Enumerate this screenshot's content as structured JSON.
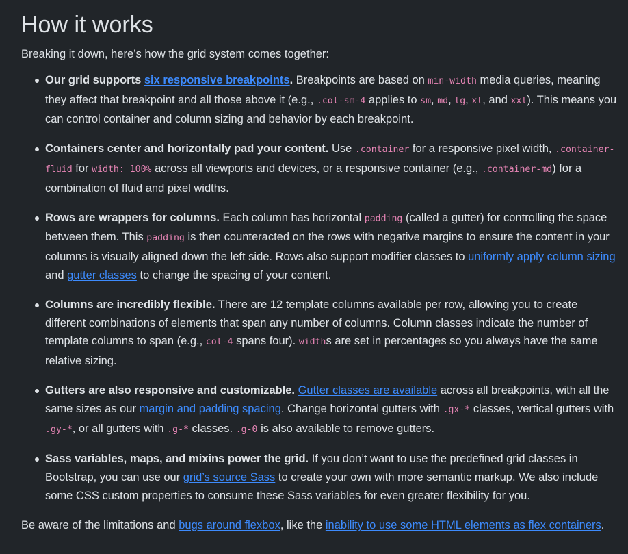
{
  "heading": "How it works",
  "intro": "Breaking it down, here’s how the grid system comes together:",
  "items": [
    {
      "bold": "Our grid supports ",
      "bold_link": "six responsive breakpoints",
      "bold_end": ".",
      "t1": " Breakpoints are based on ",
      "c1": "min-width",
      "t2": " media queries, meaning they affect that breakpoint and all those above it (e.g., ",
      "c2": ".col-sm-4",
      "t3": " applies to ",
      "c3": "sm",
      "t4": ", ",
      "c4": "md",
      "t5": ", ",
      "c5": "lg",
      "t6": ", ",
      "c6": "xl",
      "t7": ", and ",
      "c7": "xxl",
      "t8": "). This means you can control container and column sizing and behavior by each breakpoint."
    },
    {
      "bold": "Containers center and horizontally pad your content.",
      "t1": " Use ",
      "c1": ".container",
      "t2": " for a responsive pixel width, ",
      "c2": ".container-fluid",
      "t3": " for ",
      "c3": "width: 100%",
      "t4": " across all viewports and devices, or a responsive container (e.g., ",
      "c4": ".container-md",
      "t5": ") for a combination of fluid and pixel widths."
    },
    {
      "bold": "Rows are wrappers for columns.",
      "t1": " Each column has horizontal ",
      "c1": "padding",
      "t2": " (called a gutter) for controlling the space between them. This ",
      "c2": "padding",
      "t3": " is then counteracted on the rows with negative margins to ensure the content in your columns is visually aligned down the left side. Rows also support modifier classes to ",
      "l1": "uniformly apply column sizing",
      "t4": " and ",
      "l2": "gutter classes",
      "t5": " to change the spacing of your content."
    },
    {
      "bold": "Columns are incredibly flexible.",
      "t1": " There are 12 template columns available per row, allowing you to create different combinations of elements that span any number of columns. Column classes indicate the number of template columns to span (e.g., ",
      "c1": "col-4",
      "t2": " spans four). ",
      "c2": "width",
      "t3": "s are set in percentages so you always have the same relative sizing."
    },
    {
      "bold": "Gutters are also responsive and customizable.",
      "t1": " ",
      "l1": "Gutter classes are available",
      "t2": " across all breakpoints, with all the same sizes as our ",
      "l2": "margin and padding spacing",
      "t3": ". Change horizontal gutters with ",
      "c1": ".gx-*",
      "t4": " classes, vertical gutters with ",
      "c2": ".gy-*",
      "t5": ", or all gutters with ",
      "c3": ".g-*",
      "t6": " classes. ",
      "c4": ".g-0",
      "t7": " is also available to remove gutters."
    },
    {
      "bold": "Sass variables, maps, and mixins power the grid.",
      "t1": " If you don’t want to use the predefined grid classes in Bootstrap, you can use our ",
      "l1": "grid’s source Sass",
      "t2": " to create your own with more semantic markup. We also include some CSS custom properties to consume these Sass variables for even greater flexibility for you."
    }
  ],
  "footer": {
    "t1": "Be aware of the limitations and ",
    "l1": "bugs around flexbox",
    "t2": ", like the ",
    "l2": "inability to use some HTML elements as flex containers",
    "t3": "."
  },
  "colors": {
    "background": "#212529",
    "text": "#dee2e6",
    "link": "#3d8bfd",
    "code": "#e685b5"
  }
}
